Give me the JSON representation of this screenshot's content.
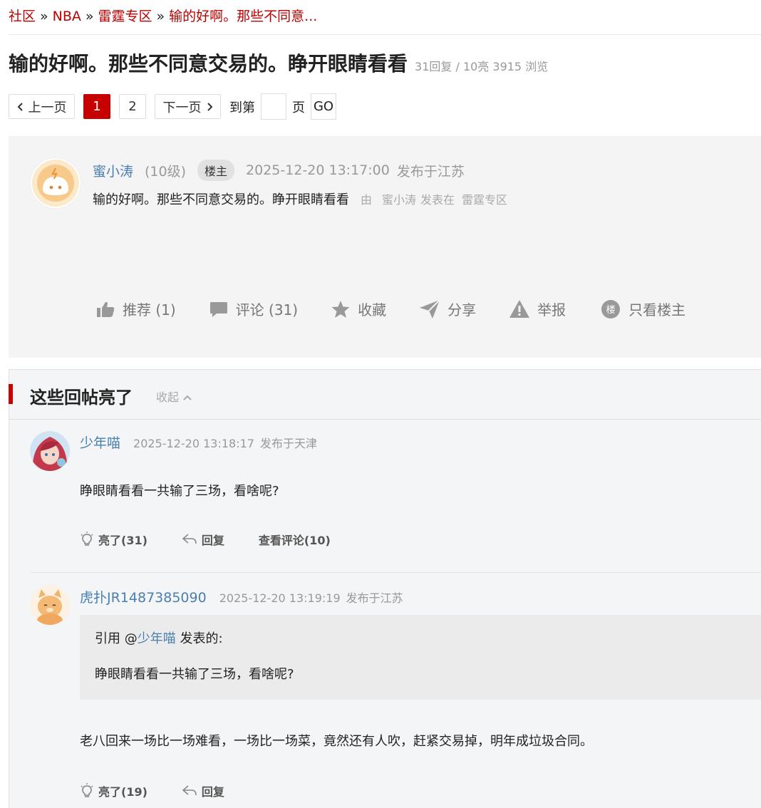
{
  "breadcrumb": {
    "items": [
      "社区",
      "NBA",
      "雷霆专区",
      "输的好啊。那些不同意..."
    ],
    "separator": "»"
  },
  "thread": {
    "title": "输的好啊。那些不同意交易的。睁开眼睛看看",
    "meta": "31回复 / 10亮 3915 浏览"
  },
  "pager": {
    "prev": "上一页",
    "pages": [
      "1",
      "2"
    ],
    "current": "1",
    "next": "下一页",
    "goto_label": "到第",
    "page_unit": "页",
    "go": "GO"
  },
  "op": {
    "username": "蜜小涛",
    "level": "(10级)",
    "badge": "楼主",
    "time": "2025-12-20 13:17:00",
    "location": "发布于江苏",
    "content": "输的好啊。那些不同意交易的。睁开眼睛看看",
    "source_by": "由",
    "source_user": "蜜小涛",
    "source_posted": "发表在",
    "source_board": "雷霆专区"
  },
  "actions": {
    "recommend": "推荐 (1)",
    "comment": "评论 (31)",
    "favorite": "收藏",
    "share": "分享",
    "report": "举报",
    "op_only_icon": "楼",
    "op_only": "只看楼主"
  },
  "lit_section": {
    "title": "这些回帖亮了",
    "collapse": "收起"
  },
  "replies": [
    {
      "username": "少年喵",
      "time": "2025-12-20 13:18:17",
      "location": "发布于天津",
      "content": "睁眼睛看看一共输了三场，看啥呢?",
      "light": "亮了(31)",
      "reply": "回复",
      "view_comments": "查看评论(10)"
    },
    {
      "username": "虎扑JR1487385090",
      "time": "2025-12-20 13:19:19",
      "location": "发布于江苏",
      "quote_prefix": "引用 @",
      "quote_user": "少年喵",
      "quote_suffix": " 发表的:",
      "quote_content": "睁眼睛看看一共输了三场，看啥呢?",
      "content": "老八回来一场比一场难看，一场比一场菜，竟然还有人吹，赶紧交易掉，明年成垃圾合同。",
      "light": "亮了(19)",
      "reply": "回复"
    }
  ],
  "colors": {
    "accent": "#c60100",
    "link": "#4a7fb0",
    "muted": "#999999"
  }
}
